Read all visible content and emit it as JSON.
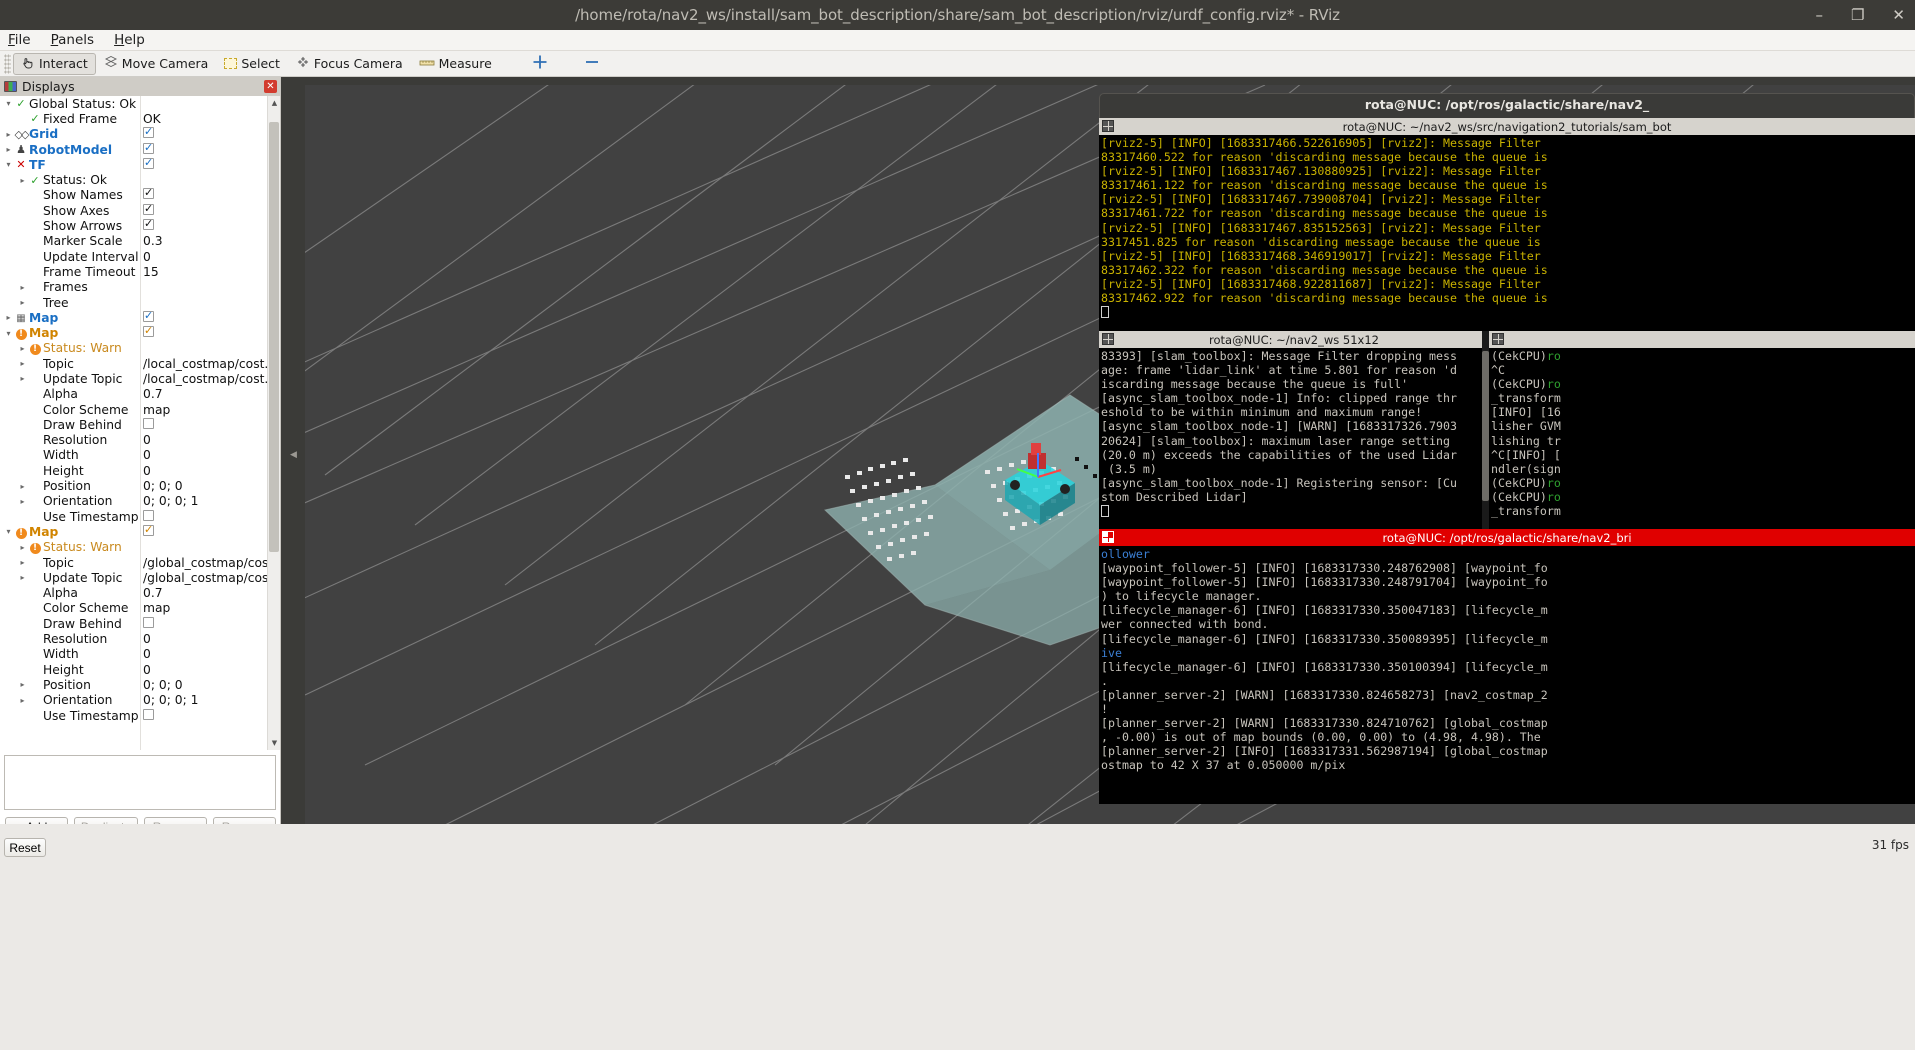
{
  "window": {
    "title": "/home/rota/nav2_ws/install/sam_bot_description/share/sam_bot_description/rviz/urdf_config.rviz* - RViz",
    "minimize": "–",
    "maximize": "❐",
    "close": "✕"
  },
  "menu": [
    {
      "label": "File"
    },
    {
      "label": "Panels"
    },
    {
      "label": "Help"
    }
  ],
  "toolbar": {
    "items": [
      {
        "label": "Interact",
        "icon": "hand-cursor-icon",
        "active": true
      },
      {
        "label": "Move Camera",
        "icon": "move-camera-icon",
        "active": false
      },
      {
        "label": "Select",
        "icon": "select-rect-icon",
        "active": false
      },
      {
        "label": "Focus Camera",
        "icon": "focus-camera-icon",
        "active": false
      },
      {
        "label": "Measure",
        "icon": "measure-icon",
        "active": false
      }
    ],
    "extra": [
      {
        "icon": "plus-move-icon"
      },
      {
        "icon": "minus-icon"
      }
    ]
  },
  "displays": {
    "header": "Displays",
    "close": "✕",
    "rows": [
      {
        "indent": 0,
        "arrow": "open",
        "icon": "check",
        "label": "Global Status: Ok",
        "style": "plain",
        "value": ""
      },
      {
        "indent": 1,
        "arrow": "none",
        "icon": "check",
        "label": "Fixed Frame",
        "style": "plain",
        "value": "OK",
        "valtype": "text"
      },
      {
        "indent": 0,
        "arrow": "closed",
        "icon": "grid",
        "label": "Grid",
        "style": "blue",
        "valtype": "check-on"
      },
      {
        "indent": 0,
        "arrow": "closed",
        "icon": "robot",
        "label": "RobotModel",
        "style": "blue",
        "valtype": "check-on"
      },
      {
        "indent": 0,
        "arrow": "open",
        "icon": "tf",
        "label": "TF",
        "style": "blue",
        "valtype": "check-on"
      },
      {
        "indent": 1,
        "arrow": "closed",
        "icon": "check",
        "label": "Status: Ok",
        "style": "plain",
        "valtype": "none"
      },
      {
        "indent": 1,
        "arrow": "none",
        "icon": "none",
        "label": "Show Names",
        "style": "plain",
        "valtype": "check-on-dark"
      },
      {
        "indent": 1,
        "arrow": "none",
        "icon": "none",
        "label": "Show Axes",
        "style": "plain",
        "valtype": "check-on-dark"
      },
      {
        "indent": 1,
        "arrow": "none",
        "icon": "none",
        "label": "Show Arrows",
        "style": "plain",
        "valtype": "check-on-dark"
      },
      {
        "indent": 1,
        "arrow": "none",
        "icon": "none",
        "label": "Marker Scale",
        "style": "plain",
        "value": "0.3",
        "valtype": "text"
      },
      {
        "indent": 1,
        "arrow": "none",
        "icon": "none",
        "label": "Update Interval",
        "style": "plain",
        "value": "0",
        "valtype": "text"
      },
      {
        "indent": 1,
        "arrow": "none",
        "icon": "none",
        "label": "Frame Timeout",
        "style": "plain",
        "value": "15",
        "valtype": "text"
      },
      {
        "indent": 1,
        "arrow": "closed",
        "icon": "none",
        "label": "Frames",
        "style": "plain",
        "valtype": "none"
      },
      {
        "indent": 1,
        "arrow": "closed",
        "icon": "none",
        "label": "Tree",
        "style": "plain",
        "valtype": "none"
      },
      {
        "indent": 0,
        "arrow": "closed",
        "icon": "map",
        "label": "Map",
        "style": "blue",
        "valtype": "check-on"
      },
      {
        "indent": 0,
        "arrow": "open",
        "icon": "warn",
        "label": "Map",
        "style": "orange",
        "valtype": "check-on-orange"
      },
      {
        "indent": 1,
        "arrow": "closed",
        "icon": "warn",
        "label": "Status: Warn",
        "style": "warn",
        "valtype": "none"
      },
      {
        "indent": 1,
        "arrow": "closed",
        "icon": "none",
        "label": "Topic",
        "style": "plain",
        "value": "/local_costmap/cost...",
        "valtype": "text"
      },
      {
        "indent": 1,
        "arrow": "closed",
        "icon": "none",
        "label": "Update Topic",
        "style": "plain",
        "value": "/local_costmap/cost...",
        "valtype": "text"
      },
      {
        "indent": 1,
        "arrow": "none",
        "icon": "none",
        "label": "Alpha",
        "style": "plain",
        "value": "0.7",
        "valtype": "text"
      },
      {
        "indent": 1,
        "arrow": "none",
        "icon": "none",
        "label": "Color Scheme",
        "style": "plain",
        "value": "map",
        "valtype": "text"
      },
      {
        "indent": 1,
        "arrow": "none",
        "icon": "none",
        "label": "Draw Behind",
        "style": "plain",
        "valtype": "check-off"
      },
      {
        "indent": 1,
        "arrow": "none",
        "icon": "none",
        "label": "Resolution",
        "style": "plain",
        "value": "0",
        "valtype": "text"
      },
      {
        "indent": 1,
        "arrow": "none",
        "icon": "none",
        "label": "Width",
        "style": "plain",
        "value": "0",
        "valtype": "text"
      },
      {
        "indent": 1,
        "arrow": "none",
        "icon": "none",
        "label": "Height",
        "style": "plain",
        "value": "0",
        "valtype": "text"
      },
      {
        "indent": 1,
        "arrow": "closed",
        "icon": "none",
        "label": "Position",
        "style": "plain",
        "value": "0; 0; 0",
        "valtype": "text"
      },
      {
        "indent": 1,
        "arrow": "closed",
        "icon": "none",
        "label": "Orientation",
        "style": "plain",
        "value": "0; 0; 0; 1",
        "valtype": "text"
      },
      {
        "indent": 1,
        "arrow": "none",
        "icon": "none",
        "label": "Use Timestamp",
        "style": "plain",
        "valtype": "check-off"
      },
      {
        "indent": 0,
        "arrow": "open",
        "icon": "warn",
        "label": "Map",
        "style": "orange",
        "valtype": "check-on-orange"
      },
      {
        "indent": 1,
        "arrow": "closed",
        "icon": "warn",
        "label": "Status: Warn",
        "style": "warn",
        "valtype": "none"
      },
      {
        "indent": 1,
        "arrow": "closed",
        "icon": "none",
        "label": "Topic",
        "style": "plain",
        "value": "/global_costmap/cost.",
        "valtype": "text"
      },
      {
        "indent": 1,
        "arrow": "closed",
        "icon": "none",
        "label": "Update Topic",
        "style": "plain",
        "value": "/global_costmap/cost.",
        "valtype": "text"
      },
      {
        "indent": 1,
        "arrow": "none",
        "icon": "none",
        "label": "Alpha",
        "style": "plain",
        "value": "0.7",
        "valtype": "text"
      },
      {
        "indent": 1,
        "arrow": "none",
        "icon": "none",
        "label": "Color Scheme",
        "style": "plain",
        "value": "map",
        "valtype": "text"
      },
      {
        "indent": 1,
        "arrow": "none",
        "icon": "none",
        "label": "Draw Behind",
        "style": "plain",
        "valtype": "check-off"
      },
      {
        "indent": 1,
        "arrow": "none",
        "icon": "none",
        "label": "Resolution",
        "style": "plain",
        "value": "0",
        "valtype": "text"
      },
      {
        "indent": 1,
        "arrow": "none",
        "icon": "none",
        "label": "Width",
        "style": "plain",
        "value": "0",
        "valtype": "text"
      },
      {
        "indent": 1,
        "arrow": "none",
        "icon": "none",
        "label": "Height",
        "style": "plain",
        "value": "0",
        "valtype": "text"
      },
      {
        "indent": 1,
        "arrow": "closed",
        "icon": "none",
        "label": "Position",
        "style": "plain",
        "value": "0; 0; 0",
        "valtype": "text"
      },
      {
        "indent": 1,
        "arrow": "closed",
        "icon": "none",
        "label": "Orientation",
        "style": "plain",
        "value": "0; 0; 0; 1",
        "valtype": "text"
      },
      {
        "indent": 1,
        "arrow": "none",
        "icon": "none",
        "label": "Use Timestamp",
        "style": "plain",
        "valtype": "check-off"
      }
    ],
    "buttons": [
      {
        "label": "Add",
        "enabled": true
      },
      {
        "label": "Duplicate",
        "enabled": false
      },
      {
        "label": "Remove",
        "enabled": false
      },
      {
        "label": "Rename",
        "enabled": false
      }
    ]
  },
  "statusbar": {
    "reset_label": "Reset",
    "fps": "31 fps"
  },
  "terminals": {
    "outer": {
      "title": "rota@NUC: /opt/ros/galactic/share/nav2_"
    },
    "top": {
      "title": "rota@NUC: ~/nav2_ws/src/navigation2_tutorials/sam_bot",
      "lines": [
        "[rviz2-5] [INFO] [1683317466.522616905] [rviz2]: Message Filter",
        "83317460.522 for reason 'discarding message because the queue is",
        "[rviz2-5] [INFO] [1683317467.130880925] [rviz2]: Message Filter",
        "83317461.122 for reason 'discarding message because the queue is",
        "[rviz2-5] [INFO] [1683317467.739008704] [rviz2]: Message Filter",
        "83317461.722 for reason 'discarding message because the queue is",
        "[rviz2-5] [INFO] [1683317467.835152563] [rviz2]: Message Filter",
        "3317451.825 for reason 'discarding message because the queue is",
        "[rviz2-5] [INFO] [1683317468.346919017] [rviz2]: Message Filter",
        "83317462.322 for reason 'discarding message because the queue is",
        "[rviz2-5] [INFO] [1683317468.922811687] [rviz2]: Message Filter",
        "83317462.922 for reason 'discarding message because the queue is"
      ]
    },
    "middle_left": {
      "title": "rota@NUC: ~/nav2_ws 51x12",
      "lines": [
        "83393] [slam_toolbox]: Message Filter dropping mess",
        "age: frame 'lidar_link' at time 5.801 for reason 'd",
        "iscarding message because the queue is full'",
        "[async_slam_toolbox_node-1] Info: clipped range thr",
        "eshold to be within minimum and maximum range!",
        "[async_slam_toolbox_node-1] [WARN] [1683317326.7903",
        "20624] [slam_toolbox]: maximum laser range setting",
        "(20.0 m) exceeds the capabilities of the used Lidar",
        " (3.5 m)",
        "[async_slam_toolbox_node-1] Registering sensor: [Cu",
        "stom Described Lidar]"
      ]
    },
    "middle_right": {
      "lines": [
        "(CekCPU)ro",
        "^C",
        "(CekCPU)ro",
        "_transform",
        "[INFO] [16",
        "lisher GVM",
        "lishing tr",
        "^C[INFO] [",
        "ndler(sign",
        "(CekCPU)ro",
        "(CekCPU)ro",
        "_transform"
      ]
    },
    "bottom": {
      "title": "rota@NUC: /opt/ros/galactic/share/nav2_bri",
      "lines": [
        "ollower",
        "[waypoint_follower-5] [INFO] [1683317330.248762908] [waypoint_fo",
        "[waypoint_follower-5] [INFO] [1683317330.248791704] [waypoint_fo",
        ") to lifecycle manager.",
        "[lifecycle_manager-6] [INFO] [1683317330.350047183] [lifecycle_m",
        "wer connected with bond.",
        "[lifecycle_manager-6] [INFO] [1683317330.350089395] [lifecycle_m",
        "ive",
        "[lifecycle_manager-6] [INFO] [1683317330.350100394] [lifecycle_m",
        ".",
        "[planner_server-2] [WARN] [1683317330.824658273] [nav2_costmap_2",
        "!",
        "[planner_server-2] [WARN] [1683317330.824710762] [global_costmap",
        ", -0.00) is out of map bounds (0.00, 0.00) to (4.98, 4.98). The",
        "[planner_server-2] [INFO] [1683317331.562987194] [global_costmap",
        "ostmap to 42 X 37 at 0.050000 m/pix"
      ]
    }
  },
  "colors": {
    "accent_blue": "#1a6fc4",
    "warn_orange": "#d18400",
    "terminal_yellow": "#c9b200",
    "red_titlebar": "#e00000",
    "view_bg": "#414141"
  }
}
